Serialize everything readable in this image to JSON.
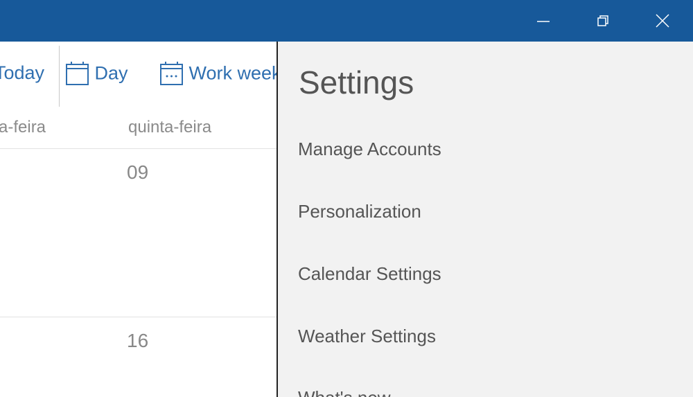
{
  "toolbar": {
    "today": "Today",
    "day": "Day",
    "work_week": "Work week"
  },
  "calendar": {
    "days": [
      "a-feira",
      "quinta-feira"
    ],
    "dates": [
      "09",
      "16"
    ]
  },
  "settings": {
    "title": "Settings",
    "items": [
      "Manage Accounts",
      "Personalization",
      "Calendar Settings",
      "Weather Settings",
      "What's new"
    ]
  },
  "colors": {
    "titlebar": "#17599a",
    "accent": "#2f6fb0"
  }
}
